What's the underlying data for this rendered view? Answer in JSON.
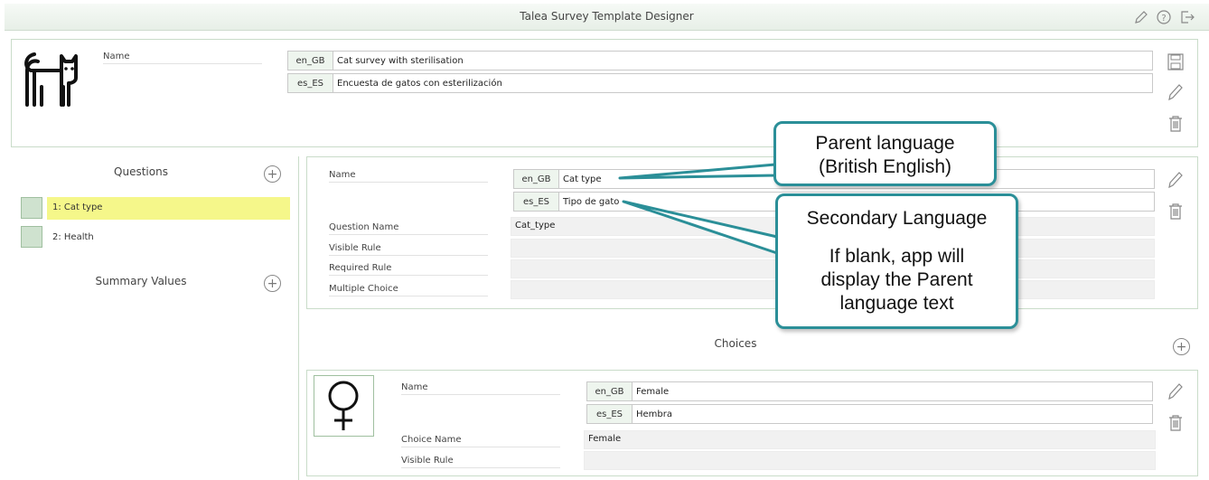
{
  "window": {
    "title": "Talea Survey Template Designer"
  },
  "template": {
    "name_label": "Name",
    "names": [
      {
        "lang": "en_GB",
        "value": "Cat survey with sterilisation"
      },
      {
        "lang": "es_ES",
        "value": "Encuesta de gatos con esterilización"
      }
    ]
  },
  "sidebar": {
    "questions_heading": "Questions",
    "questions": [
      {
        "label": "1: Cat type",
        "selected": true
      },
      {
        "label": "2: Health",
        "selected": false
      }
    ],
    "summary_heading": "Summary Values"
  },
  "question": {
    "name_label": "Name",
    "names": [
      {
        "lang": "en_GB",
        "value": "Cat type"
      },
      {
        "lang": "es_ES",
        "value": "Tipo de gato"
      }
    ],
    "question_name_label": "Question Name",
    "question_name_value": "Cat_type",
    "visible_rule_label": "Visible Rule",
    "required_rule_label": "Required Rule",
    "multiple_choice_label": "Multiple Choice"
  },
  "choices": {
    "heading": "Choices",
    "item": {
      "name_label": "Name",
      "names": [
        {
          "lang": "en_GB",
          "value": "Female"
        },
        {
          "lang": "es_ES",
          "value": "Hembra"
        }
      ],
      "choice_name_label": "Choice Name",
      "choice_name_value": "Female",
      "visible_rule_label": "Visible Rule"
    }
  },
  "callouts": {
    "parent": {
      "line1": "Parent language",
      "line2": "(British English)"
    },
    "secondary": {
      "heading": "Secondary Language",
      "line1": "If blank, app will",
      "line2": "display the Parent",
      "line3": "language text"
    }
  },
  "colors": {
    "accent": "#2b8f98",
    "selected": "#f5f78a",
    "panel_border": "#c9dcc9"
  }
}
